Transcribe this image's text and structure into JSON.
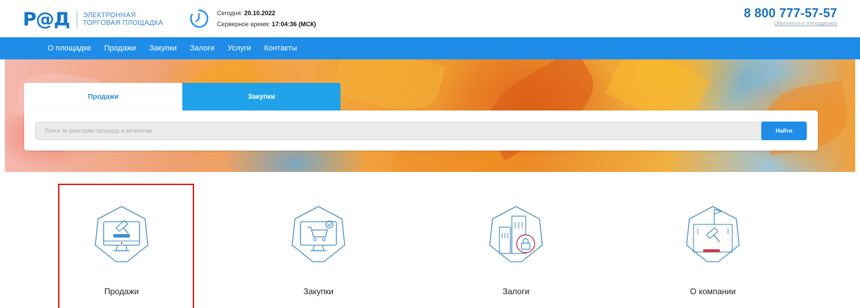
{
  "header": {
    "logo_mark": "Р@Д",
    "logo_line1": "ЭЛЕКТРОННАЯ",
    "logo_line2": "ТОРГОВАЯ ПЛОЩАДКА",
    "today_label": "Сегодня: ",
    "today_value": "20.10.2022",
    "server_label": "Серверное время: ",
    "server_value": "17:04:36 (МСК)",
    "phone": "8 800 777-57-57",
    "support_link": "Обратиться в техподдержку"
  },
  "nav": {
    "items": [
      "О площадке",
      "Продажи",
      "Закупки",
      "Залоги",
      "Услуги",
      "Контакты"
    ]
  },
  "search": {
    "tabs": [
      "Продажи",
      "Закупки"
    ],
    "active_tab": "Продажи",
    "placeholder": "Поиск по реестрам процедур и каталогам",
    "button": "Найти"
  },
  "categories": [
    {
      "label": "Продажи",
      "icon": "gavel-monitor-icon"
    },
    {
      "label": "Закупки",
      "icon": "cart-monitor-icon"
    },
    {
      "label": "Залоги",
      "icon": "buildings-lock-icon"
    },
    {
      "label": "О компании",
      "icon": "company-flag-icon"
    }
  ],
  "colors": {
    "primary": "#1f8de8",
    "tab_inactive": "#1fa2e8",
    "accent_red": "#d61c1c",
    "icon_stroke": "#4a90c2",
    "icon_accent": "#c8374a"
  }
}
